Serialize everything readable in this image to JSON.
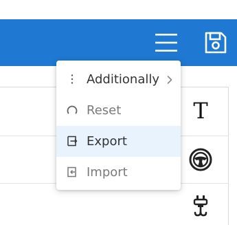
{
  "header": {
    "menu_icon": "hamburger-icon",
    "save_icon": "save-icon",
    "bar_color": "#1f78d1"
  },
  "menu": {
    "items": [
      {
        "label": "Additionally",
        "icon": "more-vertical-icon",
        "has_submenu": true,
        "state": "normal"
      },
      {
        "label": "Reset",
        "icon": "reset-icon",
        "has_submenu": false,
        "state": "disabled"
      },
      {
        "label": "Export",
        "icon": "export-icon",
        "has_submenu": false,
        "state": "highlighted"
      },
      {
        "label": "Import",
        "icon": "import-icon",
        "has_submenu": false,
        "state": "disabled"
      }
    ],
    "highlight_color": "#e8f3fd"
  },
  "panel": {
    "text_icon_glyph": "T",
    "icons": [
      "text-icon",
      "steering-wheel-icon",
      "tow-hook-icon"
    ]
  }
}
